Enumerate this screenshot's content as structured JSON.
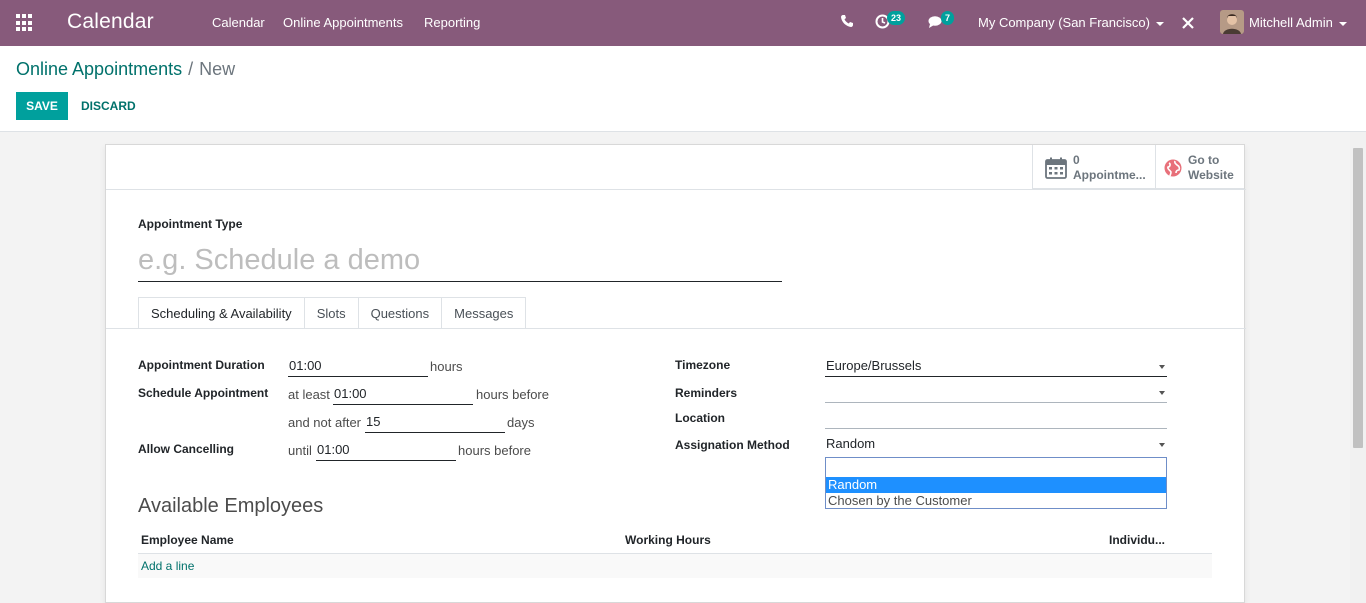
{
  "navbar": {
    "brand": "Calendar",
    "menu": [
      "Calendar",
      "Online Appointments",
      "Reporting"
    ],
    "activity_count": "23",
    "message_count": "7",
    "company": "My Company (San Francisco)",
    "user": "Mitchell Admin"
  },
  "breadcrumb": {
    "parent": "Online Appointments",
    "separator": "/",
    "current": "New"
  },
  "buttons": {
    "save": "SAVE",
    "discard": "DISCARD"
  },
  "stat_buttons": [
    {
      "value": "0",
      "label": "Appointme...",
      "icon": "calendar-icon"
    },
    {
      "value": "Go to",
      "label": "Website",
      "icon": "globe-icon"
    }
  ],
  "form": {
    "type_label": "Appointment Type",
    "name_placeholder": "e.g. Schedule a demo",
    "tabs": [
      "Scheduling & Availability",
      "Slots",
      "Questions",
      "Messages"
    ],
    "duration": {
      "label": "Appointment Duration",
      "value": "01:00",
      "unit": "hours"
    },
    "schedule": {
      "label": "Schedule Appointment",
      "prefix": "at least",
      "value": "01:00",
      "suffix": "hours before",
      "prefix2": "and not after",
      "value2": "15",
      "suffix2": "days"
    },
    "cancel": {
      "label": "Allow Cancelling",
      "prefix": "until",
      "value": "01:00",
      "suffix": "hours before"
    },
    "timezone": {
      "label": "Timezone",
      "value": "Europe/Brussels"
    },
    "reminders": {
      "label": "Reminders",
      "value": ""
    },
    "location": {
      "label": "Location",
      "value": ""
    },
    "assignation": {
      "label": "Assignation Method",
      "value": "Random",
      "options": [
        "Random",
        "Chosen by the Customer"
      ]
    },
    "employees": {
      "title": "Available Employees",
      "columns": [
        "Employee Name",
        "Working Hours",
        "Individu..."
      ],
      "add_line": "Add a line"
    }
  },
  "colors": {
    "navbar": "#875a7b",
    "primary": "#00a09d",
    "link": "#00716b",
    "selected_option": "#1e90ff"
  }
}
